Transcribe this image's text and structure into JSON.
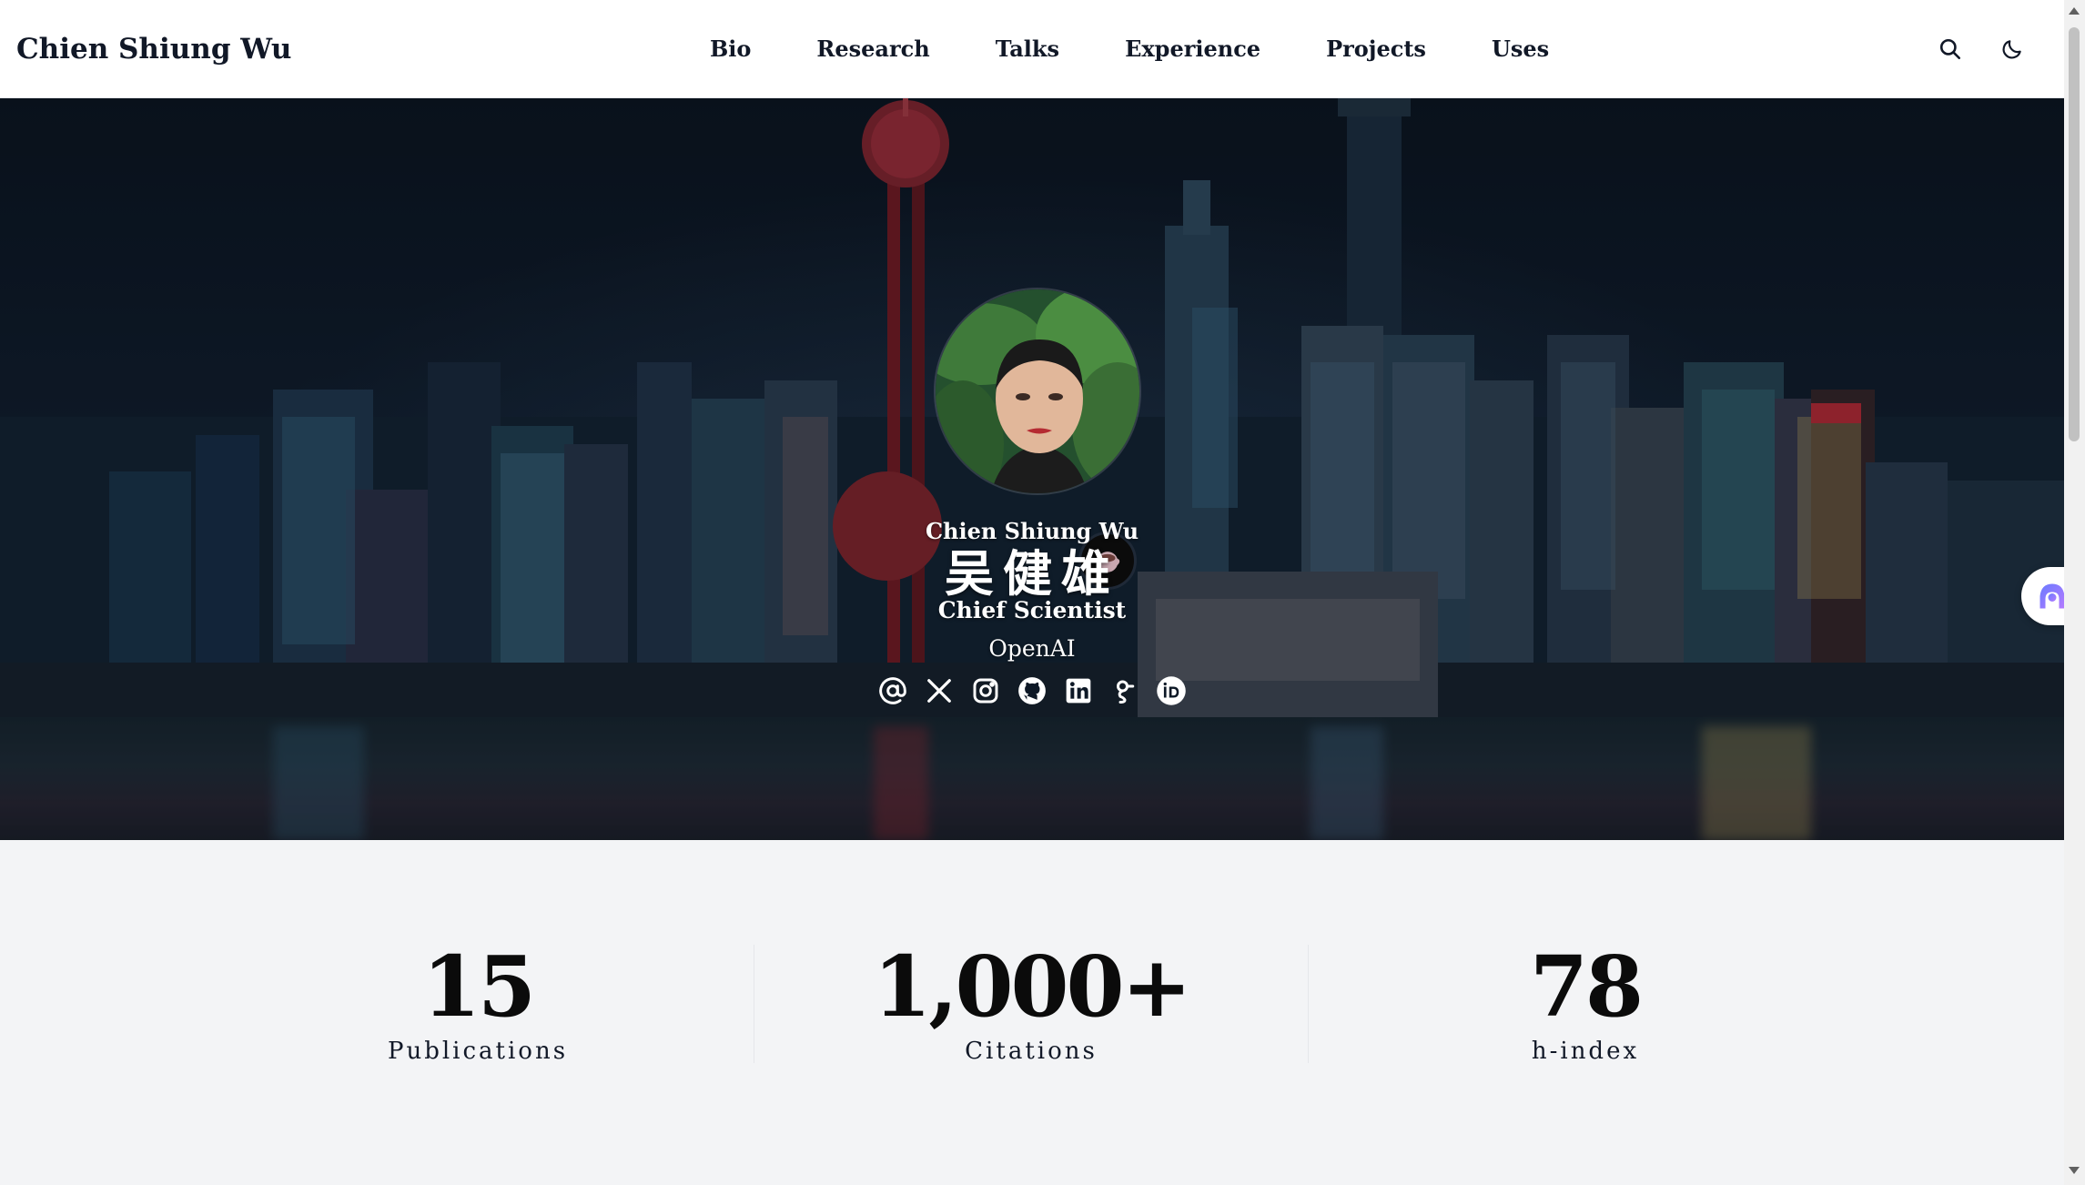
{
  "site": {
    "brand": "Chien Shiung Wu"
  },
  "nav": {
    "links": [
      "Bio",
      "Research",
      "Talks",
      "Experience",
      "Projects",
      "Uses"
    ],
    "actions": [
      "search-icon",
      "moon-icon"
    ]
  },
  "hero": {
    "name": "Chien Shiung Wu",
    "name_cjk": "吴健雄",
    "role": "Chief Scientist",
    "organization": "OpenAI",
    "avatar_badge": "coffee-cup-icon",
    "socials": [
      "at-sign-icon",
      "x-twitter-icon",
      "instagram-icon",
      "github-icon",
      "linkedin-icon",
      "google-scholar-icon",
      "orcid-icon"
    ]
  },
  "stats": [
    {
      "value": "15",
      "label": "Publications"
    },
    {
      "value": "1,000+",
      "label": "Citations"
    },
    {
      "value": "78",
      "label": "h-index"
    }
  ],
  "colors": {
    "navbar_bg": "#ffffff",
    "page_bg": "#f3f4f6",
    "text_dark": "#111827",
    "hero_overlay": "#0d1826"
  }
}
